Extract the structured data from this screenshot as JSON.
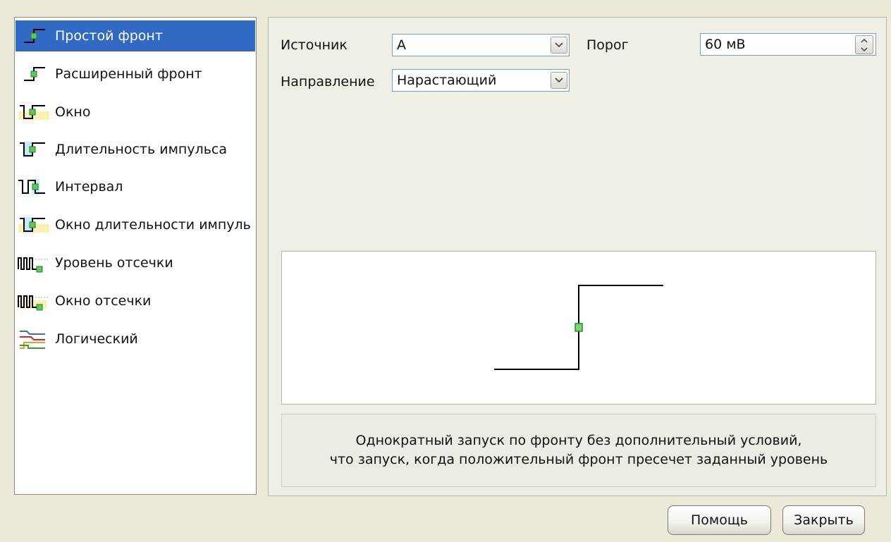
{
  "trigger_types": {
    "items": [
      {
        "label": "Простой фронт",
        "icon": "simple-edge-icon",
        "selected": true
      },
      {
        "label": "Расширенный фронт",
        "icon": "advanced-edge-icon",
        "selected": false
      },
      {
        "label": "Окно",
        "icon": "window-icon",
        "selected": false
      },
      {
        "label": "Длительность импульса",
        "icon": "pulse-width-icon",
        "selected": false
      },
      {
        "label": "Интервал",
        "icon": "interval-icon",
        "selected": false
      },
      {
        "label": "Окно длительности импуль",
        "icon": "window-pulse-width-icon",
        "selected": false
      },
      {
        "label": "Уровень отсечки",
        "icon": "level-dropout-icon",
        "selected": false
      },
      {
        "label": "Окно отсечки",
        "icon": "window-dropout-icon",
        "selected": false
      },
      {
        "label": "Логический",
        "icon": "logic-icon",
        "selected": false
      }
    ]
  },
  "settings": {
    "source_label": "Источник",
    "source_value": "A",
    "threshold_label": "Порог",
    "threshold_value": "60 мВ",
    "direction_label": "Направление",
    "direction_value": "Нарастающий"
  },
  "description": {
    "line1": "Однократный запуск по фронту без дополнительный условий,",
    "line2": "что запуск, когда положительный фронт пресечет заданный уровень"
  },
  "buttons": {
    "help_label": "Помощь",
    "close_label": "Закрыть"
  },
  "colors": {
    "selection": "#316ac5",
    "trigger_marker": "#78d478",
    "signal_line": "#000000"
  }
}
